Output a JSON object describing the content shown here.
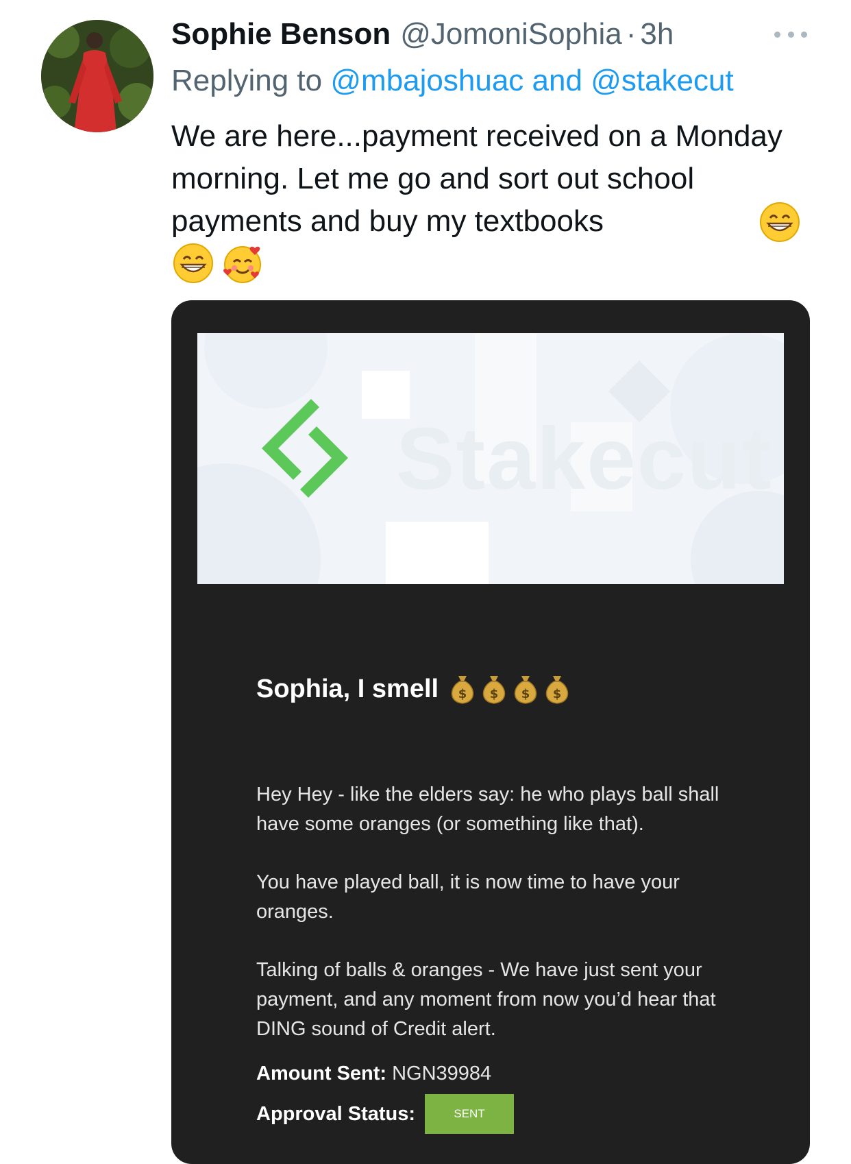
{
  "tweet": {
    "author": {
      "name": "Sophie Benson",
      "handle": "@JomoniSophia",
      "separator": "·",
      "time": "3h"
    },
    "reply": {
      "prefix": "Replying to",
      "mention_1": "@mbajoshuac",
      "conjunction": "and",
      "mention_2": "@stakecut"
    },
    "text": "We are here...payment received on a Monday morning. Let me go and sort out school payments and buy my textbooks",
    "emojis": [
      "grinning-face",
      "grinning-face",
      "smiling-face-with-hearts"
    ]
  },
  "email": {
    "brand": "Stakecut",
    "heading": "Sophia, I smell",
    "heading_emojis": [
      "money-bag",
      "money-bag",
      "money-bag",
      "money-bag"
    ],
    "paragraphs": [
      "Hey Hey - like the elders say: he who plays ball shall have some oranges (or something like that).",
      "You have played ball, it is now time to have your oranges.",
      "Talking of balls & oranges - We have just sent your payment, and any moment from now you’d hear that DING sound of Credit alert."
    ],
    "amount_label": "Amount Sent:",
    "amount_value": "NGN39984",
    "status_label": "Approval Status:",
    "status_value": "SENT"
  },
  "colors": {
    "link": "#1d9bf0",
    "muted": "#536471",
    "card_bg": "#202020",
    "brand_green": "#5cc85a",
    "status_green": "#7cb342"
  }
}
